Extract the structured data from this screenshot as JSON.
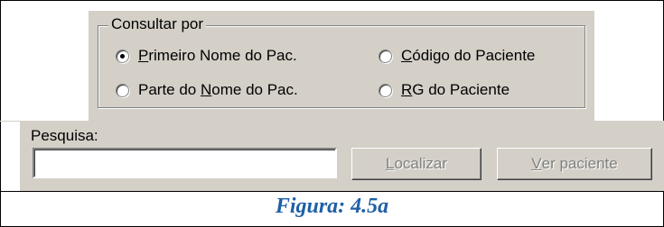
{
  "consult": {
    "title": "Consultar por",
    "options": [
      {
        "pre": "",
        "u": "P",
        "post": "rimeiro Nome do Pac.",
        "selected": true
      },
      {
        "pre": "",
        "u": "C",
        "post": "ódigo do Paciente",
        "selected": false
      },
      {
        "pre": "Parte do ",
        "u": "N",
        "post": "ome do Pac.",
        "selected": false
      },
      {
        "pre": "",
        "u": "R",
        "post": "G do Paciente",
        "selected": false
      }
    ]
  },
  "search": {
    "label": "Pesquisa:",
    "value": ""
  },
  "buttons": {
    "localizar": {
      "u": "L",
      "rest": "ocalizar",
      "enabled": false
    },
    "ver": {
      "u": "V",
      "rest": "er paciente",
      "enabled": false
    }
  },
  "caption": "Figura: 4.5a",
  "colors": {
    "face": "#d4d0c8",
    "caption": "#1f5fa6",
    "disabled_text": "#808080"
  }
}
